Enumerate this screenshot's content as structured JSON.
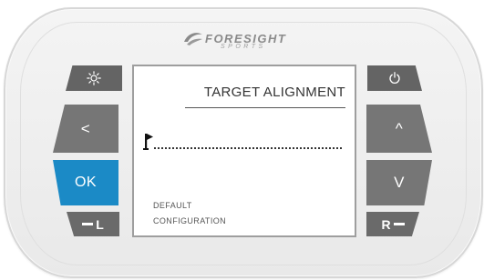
{
  "logo": {
    "brand": "FORESIGHT",
    "sub": "SPORTS"
  },
  "screen": {
    "title": "TARGET ALIGNMENT",
    "config_line1": "DEFAULT",
    "config_line2": "CONFIGURATION"
  },
  "buttons": {
    "left_arrow": "<",
    "ok": "OK",
    "up_arrow": "^",
    "down_arrow": "V",
    "left_hand": "L",
    "right_hand": "R"
  },
  "icons": {
    "brightness": "sun-icon",
    "power": "power-icon",
    "target": "flag-icon",
    "logo": "logo-mark-icon"
  },
  "colors": {
    "ok_button": "#1b8ac6",
    "button_gray": "#6c6c6c",
    "body": "#ececec"
  }
}
